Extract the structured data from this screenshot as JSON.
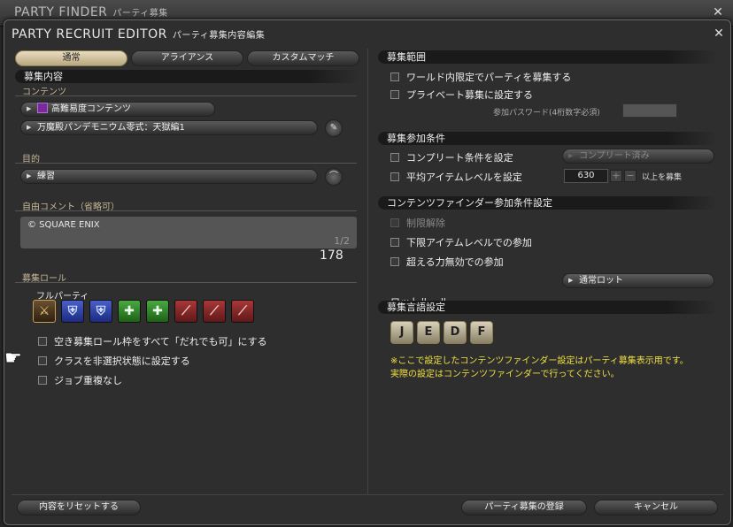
{
  "bg_window": {
    "title": "PARTY FINDER",
    "subtitle": "パーティ募集"
  },
  "window": {
    "title": "PARTY RECRUIT EDITOR",
    "subtitle": "パーティ募集内容編集"
  },
  "tabs": [
    {
      "label": "通常",
      "active": true
    },
    {
      "label": "アライアンス",
      "active": false
    },
    {
      "label": "カスタムマッチ",
      "active": false
    }
  ],
  "left": {
    "recruit_header": "募集内容",
    "content_label": "コンテンツ",
    "duty_category": "高難易度コンテンツ",
    "duty_name": "万魔殿パンデモニウム零式：天獄編1",
    "purpose_label": "目的",
    "purpose": "練習",
    "comment_label": "自由コメント（省略可）",
    "comment": "© SQUARE ENIX",
    "comment_page": "1/2",
    "comment_count": "178",
    "role_header": "募集ロール",
    "full_party": "フルパーティ",
    "roles": [
      {
        "type": "any",
        "icon": "all-roles-icon"
      },
      {
        "type": "tank",
        "icon": "tank-icon"
      },
      {
        "type": "tank",
        "icon": "tank-icon"
      },
      {
        "type": "heal",
        "icon": "healer-icon"
      },
      {
        "type": "heal",
        "icon": "healer-icon"
      },
      {
        "type": "dps",
        "icon": "dps-icon"
      },
      {
        "type": "dps",
        "icon": "dps-icon"
      },
      {
        "type": "dps",
        "icon": "dps-icon"
      }
    ],
    "options": [
      "空き募集ロール枠をすべて「だれでも可」にする",
      "クラスを非選択状態に設定する",
      "ジョブ重複なし"
    ]
  },
  "right": {
    "scope_header": "募集範囲",
    "scope_world": "ワールド内限定でパーティを募集する",
    "scope_private": "プライベート募集に設定する",
    "password_label": "参加パスワード(4桁数字必須)",
    "conditions_header": "募集参加条件",
    "complete_cond": "コンプリート条件を設定",
    "complete_value": "コンプリート済み",
    "avg_ilvl": "平均アイテムレベルを設定",
    "ilvl_value": "630",
    "ilvl_plus": "+",
    "ilvl_minus": "−",
    "ilvl_suffix": "以上を募集",
    "cf_header": "コンテンツファインダー参加条件設定",
    "cf_unrestricted": "制限解除",
    "cf_min_ilvl": "下限アイテムレベルでの参加",
    "cf_echo": "超える力無効での参加",
    "loot_label": "ロットルール",
    "loot_value": "通常ロット",
    "lang_header": "募集言語設定",
    "langs": [
      "J",
      "E",
      "D",
      "F"
    ],
    "note_line1": "※ここで設定したコンテンツファインダー設定はパーティ募集表示用です。",
    "note_line2": "実際の設定はコンテンツファインダーで行ってください。"
  },
  "footer": {
    "reset": "内容をリセットする",
    "register": "パーティ募集の登録",
    "cancel": "キャンセル"
  },
  "close_glyph": "✕"
}
